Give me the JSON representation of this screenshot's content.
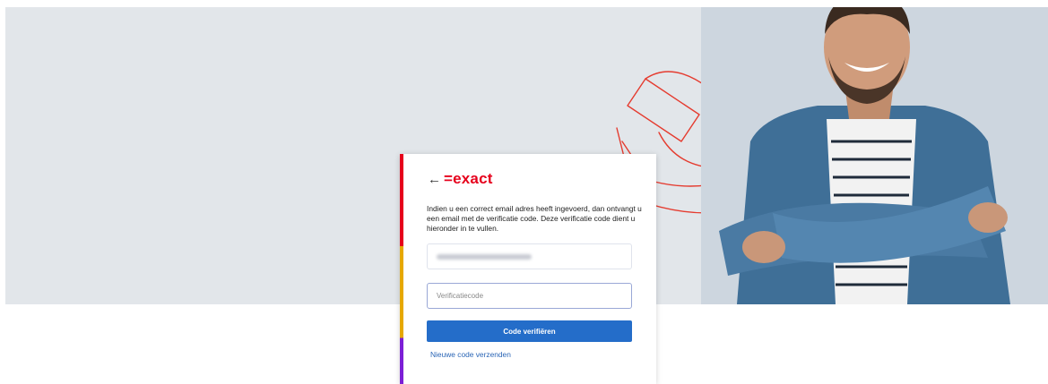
{
  "brand": {
    "logo_text": "=exact",
    "accent_color": "#e6001c"
  },
  "card": {
    "back_icon": "←",
    "intro_text": "Indien u een correct email adres heeft ingevoerd, dan ontvangt u een email met de verificatie code. Deze verificatie code dient u hieronder in te vullen.",
    "code_placeholder": "Verificatiecode",
    "verify_button": "Code verifiëren",
    "resend_link": "Nieuwe code verzenden"
  },
  "colors": {
    "hero_bg": "#e2e6ea",
    "button": "#246dc9",
    "stripe": [
      "#e6001c",
      "#e6a800",
      "#7c1fd6"
    ]
  }
}
